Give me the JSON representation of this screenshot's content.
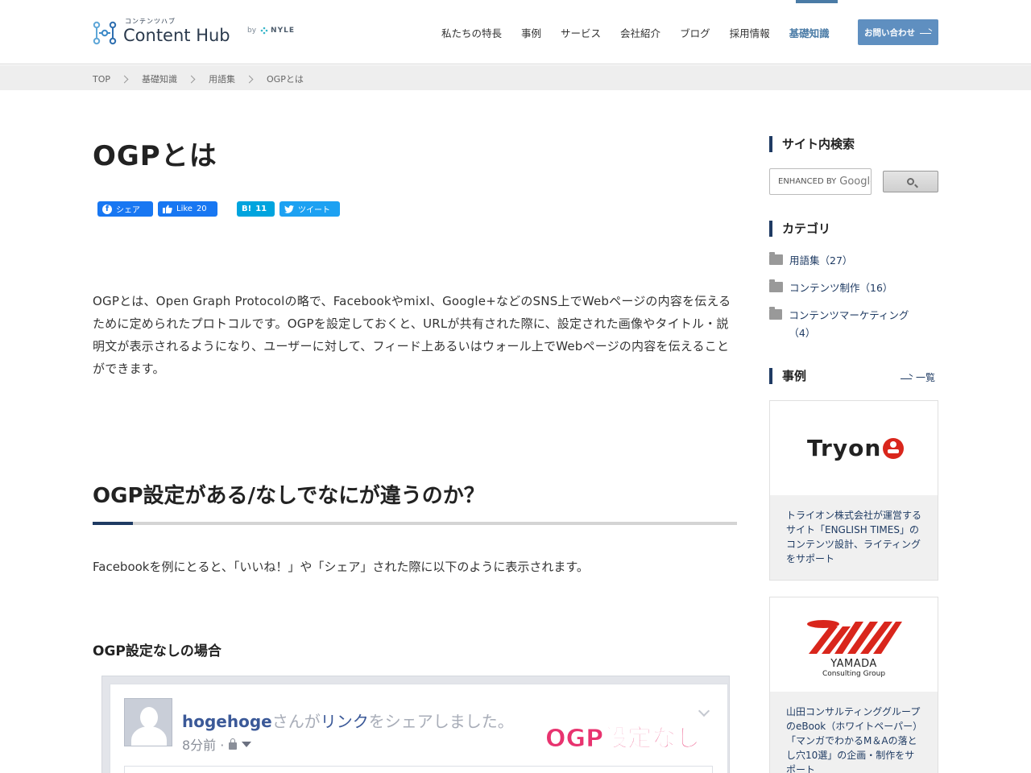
{
  "header": {
    "logo_sub": "コンテンツハブ",
    "logo_main": "Content Hub",
    "logo_by": "by",
    "logo_nyle": "NYLE",
    "nav": [
      {
        "label": "私たちの特長"
      },
      {
        "label": "事例"
      },
      {
        "label": "サービス"
      },
      {
        "label": "会社紹介"
      },
      {
        "label": "ブログ"
      },
      {
        "label": "採用情報"
      },
      {
        "label": "基礎知識",
        "active": true
      }
    ],
    "contact_label": "お問い合わせ"
  },
  "breadcrumb": [
    "TOP",
    "基礎知識",
    "用語集",
    "OGPとは"
  ],
  "article": {
    "title": "OGPとは",
    "share": {
      "facebook": "シェア",
      "like": "Like",
      "like_count": "20",
      "hatena_icon": "B!",
      "hatena_count": "11",
      "tweet": "ツイート"
    },
    "lead": "OGPとは、Open Graph Protocolの略で、FacebookやmixI、Google+などのSNS上でWebページの内容を伝えるために定められたプロトコルです。OGPを設定しておくと、URLが共有された際に、設定された画像やタイトル・説明文が表示されるようになり、ユーザーに対して、フィード上あるいはウォール上でWebページの内容を伝えることができます。",
    "h2": "OGP設定がある/なしでなにが違うのか？",
    "para2": "Facebookを例にとると、「いいね！」や「シェア」された際に以下のように表示されます。",
    "h3": "OGP設定なしの場合",
    "fb_mock": {
      "user": "hogehoge",
      "text_1": "さんが",
      "link": "リンク",
      "text_2": "をシェアしました。",
      "time": "8分前 ·",
      "overlay": "OGP設定なし"
    }
  },
  "sidebar": {
    "search_title": "サイト内検索",
    "search_placeholder": "ENHANCED BY",
    "search_google": "Google",
    "category_title": "カテゴリ",
    "categories": [
      {
        "label": "用語集（27）"
      },
      {
        "label": "コンテンツ制作（16）"
      },
      {
        "label": "コンテンツマーケティング（4）"
      }
    ],
    "cases_title": "事例",
    "cases_more": "一覧",
    "cases": [
      {
        "logo": "Tryon",
        "text": "トライオン株式会社が運営するサイト「ENGLISH TIMES」のコンテンツ設計、ライティングをサポート"
      },
      {
        "logo": "YAMADA",
        "logo_sub": "Consulting Group",
        "text": "山田コンサルティンググループのeBook（ホワイトペーパー）「マンガでわかるM＆Aの落とし穴10選」の企画・制作をサポート"
      }
    ]
  },
  "colors": {
    "accent": "#4a7ba6",
    "navy": "#1f3b63",
    "contact_button": "#5f8fc0",
    "facebook": "#1877f2",
    "hatena": "#00a4de",
    "twitter": "#1da1f2",
    "overlay_pink": "#e8336f"
  }
}
